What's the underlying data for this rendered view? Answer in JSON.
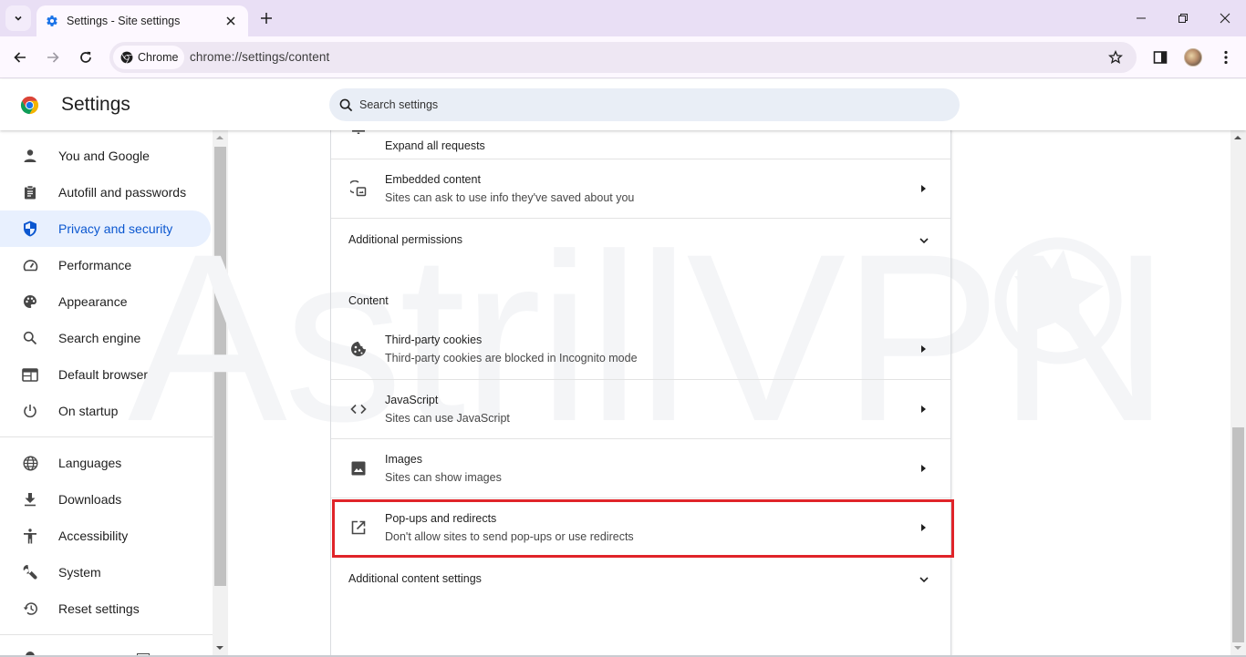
{
  "browser": {
    "tab": {
      "title": "Settings - Site settings",
      "icon": "gear-icon"
    },
    "new_tab_label": "+",
    "chip_label": "Chrome",
    "url": "chrome://settings/content"
  },
  "header": {
    "title": "Settings",
    "search_placeholder": "Search settings"
  },
  "sidebar": {
    "items": [
      {
        "label": "You and Google",
        "icon": "person-icon"
      },
      {
        "label": "Autofill and passwords",
        "icon": "clipboard-icon"
      },
      {
        "label": "Privacy and security",
        "icon": "shield-icon",
        "active": true
      },
      {
        "label": "Performance",
        "icon": "speedometer-icon"
      },
      {
        "label": "Appearance",
        "icon": "palette-icon"
      },
      {
        "label": "Search engine",
        "icon": "search-icon"
      },
      {
        "label": "Default browser",
        "icon": "browser-window-icon"
      },
      {
        "label": "On startup",
        "icon": "power-icon"
      },
      {
        "label": "Languages",
        "icon": "globe-icon"
      },
      {
        "label": "Downloads",
        "icon": "download-icon"
      },
      {
        "label": "Accessibility",
        "icon": "accessibility-icon"
      },
      {
        "label": "System",
        "icon": "wrench-icon"
      },
      {
        "label": "Reset settings",
        "icon": "reset-history-icon"
      }
    ]
  },
  "main": {
    "partial_row": {
      "subtitle": "Expand all requests"
    },
    "embedded": {
      "title": "Embedded content",
      "subtitle": "Sites can ask to use info they've saved about you"
    },
    "additional_permissions": "Additional permissions",
    "content_section": "Content",
    "content_rows": [
      {
        "title": "Third-party cookies",
        "subtitle": "Third-party cookies are blocked in Incognito mode",
        "icon": "cookie-icon"
      },
      {
        "title": "JavaScript",
        "subtitle": "Sites can use JavaScript",
        "icon": "code-icon"
      },
      {
        "title": "Images",
        "subtitle": "Sites can show images",
        "icon": "image-icon"
      },
      {
        "title": "Pop-ups and redirects",
        "subtitle": "Don't allow sites to send pop-ups or use redirects",
        "icon": "open-in-new-icon",
        "highlighted": true
      }
    ],
    "additional_content": "Additional content settings"
  },
  "watermark": {
    "text": "AstrillVPN"
  },
  "colors": {
    "accent": "#0b57d0",
    "active_bg": "#e8f0fe",
    "highlight_border": "#e02429",
    "tabstrip": "#e9dff5"
  }
}
